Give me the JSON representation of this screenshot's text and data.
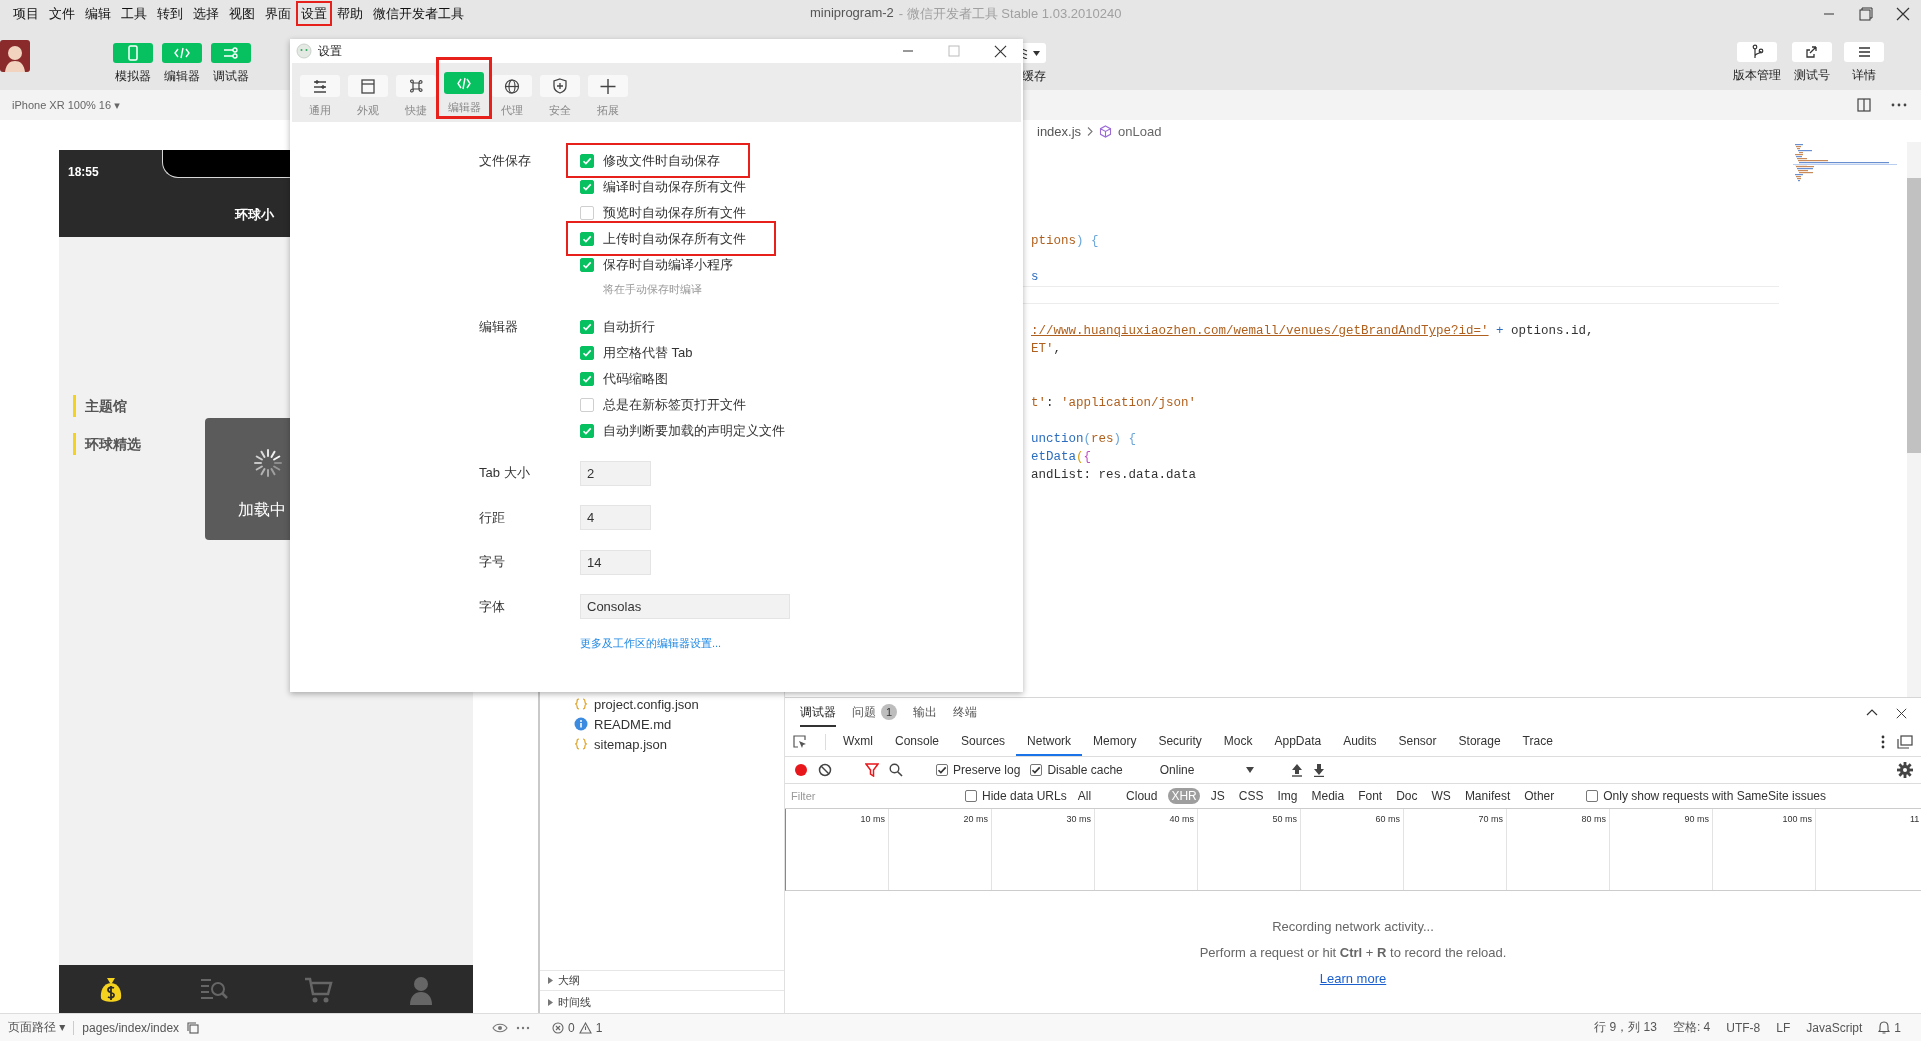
{
  "menu_bar": {
    "items": [
      {
        "label": "项目",
        "highlighted": false
      },
      {
        "label": "文件",
        "highlighted": false
      },
      {
        "label": "编辑",
        "highlighted": false
      },
      {
        "label": "工具",
        "highlighted": false
      },
      {
        "label": "转到",
        "highlighted": false
      },
      {
        "label": "选择",
        "highlighted": false
      },
      {
        "label": "视图",
        "highlighted": false
      },
      {
        "label": "界面",
        "highlighted": false
      },
      {
        "label": "设置",
        "highlighted": true
      },
      {
        "label": "帮助",
        "highlighted": false
      },
      {
        "label": "微信开发者工具",
        "highlighted": false
      }
    ],
    "title": "miniprogram-2",
    "subtitle": "- 微信开发者工具 Stable 1.03.2010240"
  },
  "toolbar": {
    "left_buttons": [
      {
        "label": "模拟器",
        "on": true
      },
      {
        "label": "编辑器",
        "on": true
      },
      {
        "label": "调试器",
        "on": true
      }
    ],
    "cache_button": {
      "label": "缓存"
    },
    "right_buttons": [
      {
        "label": "版本管理"
      },
      {
        "label": "测试号"
      },
      {
        "label": "详情"
      }
    ]
  },
  "simulator": {
    "device": "iPhone XR 100% 16 ▾",
    "time": "18:55",
    "nav_title": "环球小",
    "side_items": [
      "主题馆",
      "环球精选"
    ],
    "toast": "加载中"
  },
  "file_tree": {
    "items": [
      {
        "name": "project.config.json",
        "kind": "json"
      },
      {
        "name": "README.md",
        "kind": "info"
      },
      {
        "name": "sitemap.json",
        "kind": "json"
      }
    ],
    "panels": [
      "大纲",
      "时间线"
    ]
  },
  "editor": {
    "breadcrumb": [
      "index.js",
      "onLoad"
    ],
    "lines": [
      {
        "kind": "blank"
      },
      {
        "kind": "blank"
      },
      {
        "kind": "blank"
      },
      {
        "kind": "blank"
      },
      {
        "kind": "blank"
      },
      {
        "kind": "code",
        "tokens": [
          {
            "text": "ptions",
            "kind": "param"
          },
          {
            "text": ") {",
            "kind": "bracket"
          }
        ]
      },
      {
        "kind": "blank"
      },
      {
        "kind": "code",
        "tokens": [
          {
            "text": "s",
            "kind": "func"
          }
        ]
      },
      {
        "kind": "current"
      },
      {
        "kind": "blank"
      },
      {
        "kind": "code",
        "tokens": [
          {
            "text": "://www.huanqiuxiaozhen.com/wemall/venues/getBrandAndType?id='",
            "kind": "link"
          },
          {
            "text": " + ",
            "kind": "op"
          },
          {
            "text": "options.id,",
            "kind": "plain"
          }
        ]
      },
      {
        "kind": "code",
        "tokens": [
          {
            "text": "ET'",
            "kind": "string"
          },
          {
            "text": ",",
            "kind": "plain"
          }
        ]
      },
      {
        "kind": "blank"
      },
      {
        "kind": "blank"
      },
      {
        "kind": "code",
        "tokens": [
          {
            "text": "t'",
            "kind": "string"
          },
          {
            "text": ": ",
            "kind": "plain"
          },
          {
            "text": "'application/json'",
            "kind": "string"
          }
        ]
      },
      {
        "kind": "blank"
      },
      {
        "kind": "code",
        "tokens": [
          {
            "text": "unction",
            "kind": "func"
          },
          {
            "text": "(",
            "kind": "bracket"
          },
          {
            "text": "res",
            "kind": "param"
          },
          {
            "text": ") {",
            "kind": "bracket"
          }
        ]
      },
      {
        "kind": "code",
        "tokens": [
          {
            "text": "etData",
            "kind": "func"
          },
          {
            "text": "(",
            "kind": "bracket2"
          },
          {
            "text": "{",
            "kind": "bracket3"
          }
        ]
      },
      {
        "kind": "code",
        "tokens": [
          {
            "text": "andList: res.data.data",
            "kind": "plain"
          }
        ]
      }
    ]
  },
  "devtools": {
    "top_tabs": [
      {
        "label": "调试器",
        "selected": true
      },
      {
        "label": "问题",
        "selected": false,
        "badge": "1"
      },
      {
        "label": "输出",
        "selected": false
      },
      {
        "label": "终端",
        "selected": false
      }
    ],
    "panel_tabs": [
      {
        "label": "Wxml",
        "selected": false
      },
      {
        "label": "Console",
        "selected": false
      },
      {
        "label": "Sources",
        "selected": false
      },
      {
        "label": "Network",
        "selected": true
      },
      {
        "label": "Memory",
        "selected": false
      },
      {
        "label": "Security",
        "selected": false
      },
      {
        "label": "Mock",
        "selected": false
      },
      {
        "label": "AppData",
        "selected": false
      },
      {
        "label": "Audits",
        "selected": false
      },
      {
        "label": "Sensor",
        "selected": false
      },
      {
        "label": "Storage",
        "selected": false
      },
      {
        "label": "Trace",
        "selected": false
      }
    ],
    "preserve_log": {
      "label": "Preserve log",
      "checked": true
    },
    "disable_cache": {
      "label": "Disable cache",
      "checked": true
    },
    "throttle": "Online",
    "filter_placeholder": "Filter",
    "hide_data_urls": {
      "label": "Hide data URLs",
      "checked": false
    },
    "types": [
      {
        "label": "All",
        "selected": false
      },
      {
        "label": "Cloud",
        "selected": false
      },
      {
        "label": "XHR",
        "selected": true
      },
      {
        "label": "JS",
        "selected": false
      },
      {
        "label": "CSS",
        "selected": false
      },
      {
        "label": "Img",
        "selected": false
      },
      {
        "label": "Media",
        "selected": false
      },
      {
        "label": "Font",
        "selected": false
      },
      {
        "label": "Doc",
        "selected": false
      },
      {
        "label": "WS",
        "selected": false
      },
      {
        "label": "Manifest",
        "selected": false
      },
      {
        "label": "Other",
        "selected": false
      }
    ],
    "samesite": {
      "label": "Only show requests with SameSite issues",
      "checked": false
    },
    "timeline_ticks": [
      "10 ms",
      "20 ms",
      "30 ms",
      "40 ms",
      "50 ms",
      "60 ms",
      "70 ms",
      "80 ms",
      "90 ms",
      "100 ms",
      "11"
    ],
    "message": "Recording network activity...",
    "hint": "Perform a request or hit **Ctrl** + **R** to record the reload.",
    "link": "Learn more"
  },
  "status_bar": {
    "page_path_label": "页面路径 ▾",
    "page_path": "pages/index/index",
    "errors": "0",
    "warnings": "1",
    "position": "行 9，列 13",
    "indent": "空格: 4",
    "encoding": "UTF-8",
    "eol": "LF",
    "language": "JavaScript",
    "notifications": "1"
  },
  "dialog": {
    "title": "设置",
    "tabs": [
      {
        "label": "通用",
        "selected": false,
        "highlighted": false
      },
      {
        "label": "外观",
        "selected": false,
        "highlighted": false
      },
      {
        "label": "快捷",
        "selected": false,
        "highlighted": false
      },
      {
        "label": "编辑器",
        "selected": true,
        "highlighted": true
      },
      {
        "label": "代理",
        "selected": false,
        "highlighted": false
      },
      {
        "label": "安全",
        "selected": false,
        "highlighted": false
      },
      {
        "label": "拓展",
        "selected": false,
        "highlighted": false
      }
    ],
    "sections": [
      {
        "label": "文件保存",
        "options": [
          {
            "label": "修改文件时自动保存",
            "checked": true,
            "highlighted": true
          },
          {
            "label": "编译时自动保存所有文件",
            "checked": true,
            "highlighted": false
          },
          {
            "label": "预览时自动保存所有文件",
            "checked": false,
            "highlighted": false
          },
          {
            "label": "上传时自动保存所有文件",
            "checked": true,
            "highlighted": true
          },
          {
            "label": "保存时自动编译小程序",
            "checked": true,
            "highlighted": false,
            "note": "将在手动保存时编译"
          }
        ]
      },
      {
        "label": "编辑器",
        "options": [
          {
            "label": "自动折行",
            "checked": true,
            "highlighted": false
          },
          {
            "label": "用空格代替 Tab",
            "checked": true,
            "highlighted": false
          },
          {
            "label": "代码缩略图",
            "checked": true,
            "highlighted": false
          },
          {
            "label": "总是在新标签页打开文件",
            "checked": false,
            "highlighted": false
          },
          {
            "label": "自动判断要加载的声明定义文件",
            "checked": true,
            "highlighted": false
          }
        ]
      }
    ],
    "fields": [
      {
        "label": "Tab 大小",
        "value": "2",
        "kind": "short"
      },
      {
        "label": "行距",
        "value": "4",
        "kind": "short"
      },
      {
        "label": "字号",
        "value": "14",
        "kind": "short"
      },
      {
        "label": "字体",
        "value": "Consolas",
        "kind": "wide"
      }
    ],
    "link": "更多及工作区的编辑器设置..."
  }
}
